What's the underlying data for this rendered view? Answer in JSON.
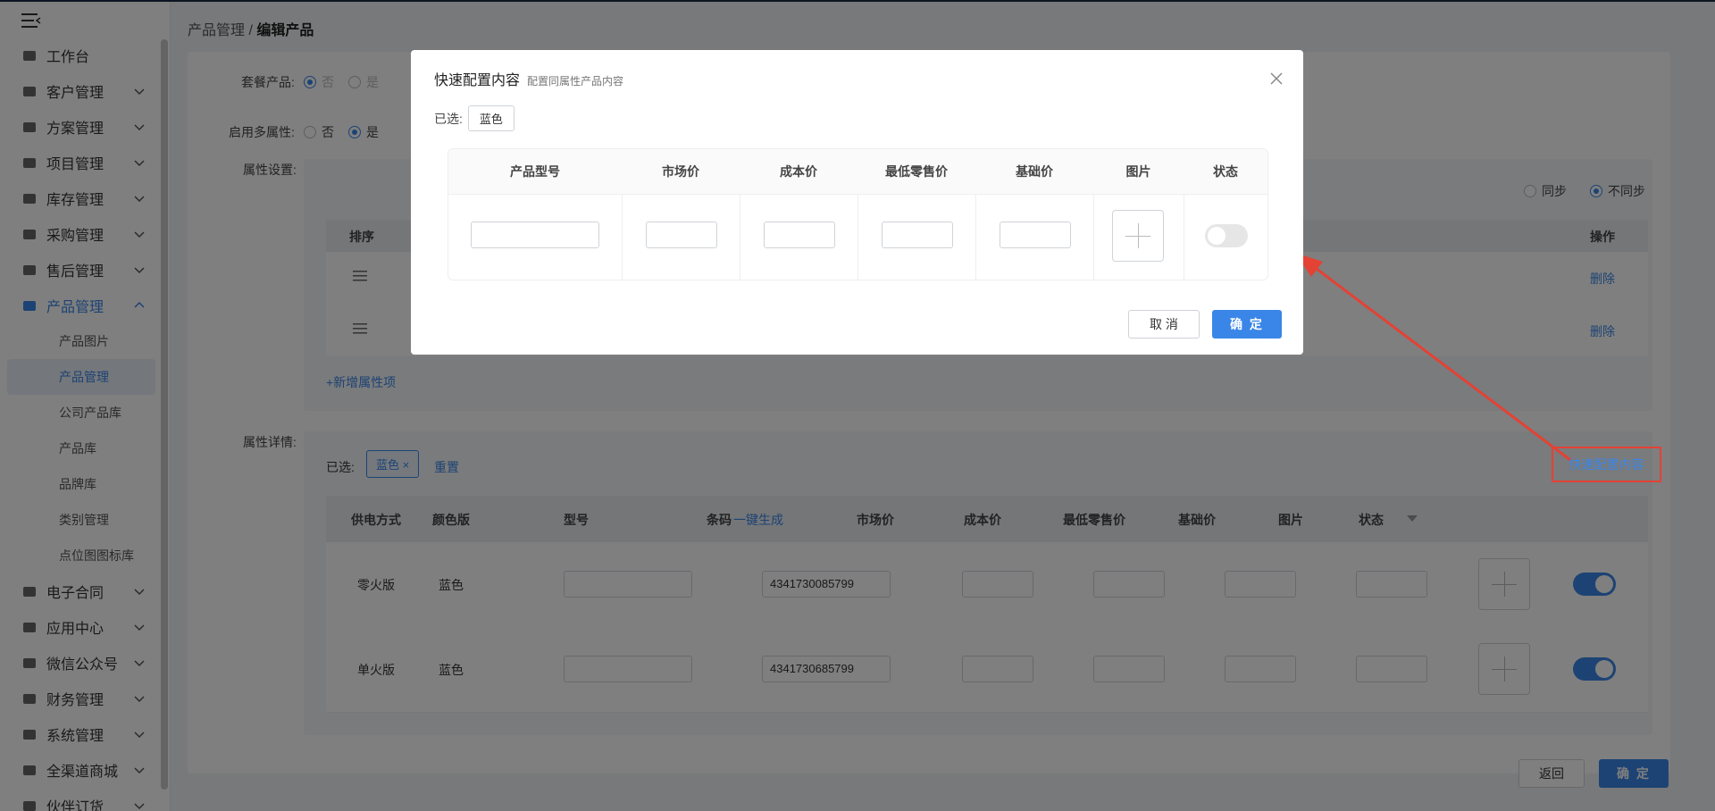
{
  "sidebar": {
    "items": [
      {
        "label": "工作台",
        "icon": "home-icon"
      },
      {
        "label": "客户管理",
        "icon": "users-icon"
      },
      {
        "label": "方案管理",
        "icon": "clipboard-icon"
      },
      {
        "label": "项目管理",
        "icon": "folder-icon"
      },
      {
        "label": "库存管理",
        "icon": "boxes-icon"
      },
      {
        "label": "采购管理",
        "icon": "cart-icon"
      },
      {
        "label": "售后管理",
        "icon": "headset-icon"
      },
      {
        "label": "产品管理",
        "icon": "box-icon"
      },
      {
        "label": "电子合同",
        "icon": "contract-icon"
      },
      {
        "label": "应用中心",
        "icon": "apps-icon"
      },
      {
        "label": "微信公众号",
        "icon": "wechat-icon"
      },
      {
        "label": "财务管理",
        "icon": "finance-icon"
      },
      {
        "label": "系统管理",
        "icon": "settings-icon"
      },
      {
        "label": "全渠道商城",
        "icon": "mall-icon"
      },
      {
        "label": "伙伴订货",
        "icon": "partner-icon"
      }
    ],
    "subitems": [
      "产品图片",
      "产品管理",
      "公司产品库",
      "产品库",
      "品牌库",
      "类别管理",
      "点位图图标库"
    ]
  },
  "breadcrumb": {
    "parent": "产品管理",
    "separator": "/",
    "current": "编辑产品"
  },
  "form": {
    "package_label": "套餐产品:",
    "package_no": "否",
    "package_yes": "是",
    "multi_label": "启用多属性:",
    "multi_no": "否",
    "multi_yes": "是",
    "attr_settings_label": "属性设置:",
    "sync": "同步",
    "nosync": "不同步",
    "col_sort": "排序",
    "col_ops": "操作",
    "delete": "删除",
    "add_attr": "+新增属性项",
    "attr_detail_label": "属性详情:",
    "selected_label": "已选:",
    "selected_tag": "蓝色",
    "reset": "重置",
    "quick_config": "快速配置内容"
  },
  "detail_table": {
    "headers": [
      "供电方式",
      "颜色版",
      "型号",
      "条码",
      "市场价",
      "成本价",
      "最低零售价",
      "基础价",
      "图片",
      "状态"
    ],
    "generate": "一键生成",
    "rows": [
      {
        "power": "零火版",
        "color": "蓝色",
        "barcode": "4341730085799"
      },
      {
        "power": "单火版",
        "color": "蓝色",
        "barcode": "4341730685799"
      }
    ]
  },
  "footer": {
    "back": "返回",
    "confirm": "确 定"
  },
  "modal": {
    "title": "快速配置内容",
    "subtitle": "配置同属性产品内容",
    "selected_label": "已选:",
    "selected_tag": "蓝色",
    "headers": [
      "产品型号",
      "市场价",
      "成本价",
      "最低零售价",
      "基础价",
      "图片",
      "状态"
    ],
    "cancel": "取 消",
    "confirm": "确 定"
  },
  "colors": {
    "accent": "#3a86e8",
    "annotation": "#e34235"
  }
}
